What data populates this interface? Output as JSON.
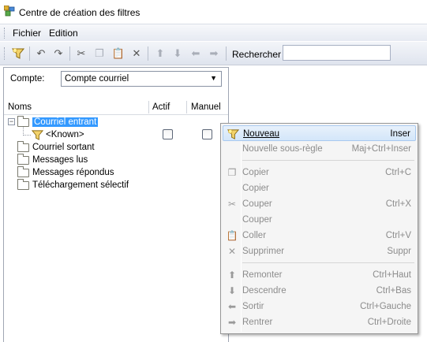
{
  "window": {
    "title": "Centre de création des filtres"
  },
  "menubar": {
    "file": "Fichier",
    "edit": "Edition"
  },
  "toolbar": {
    "search_label": "Rechercher",
    "search_value": ""
  },
  "account": {
    "label": "Compte:",
    "selected": "Compte courriel"
  },
  "columns": {
    "name": "Noms",
    "active": "Actif",
    "manual": "Manuel"
  },
  "tree": {
    "items": [
      {
        "label": "Courriel entrant"
      },
      {
        "label": "<Known>"
      },
      {
        "label": "Courriel sortant"
      },
      {
        "label": "Messages lus"
      },
      {
        "label": "Messages répondus"
      },
      {
        "label": "Téléchargement sélectif"
      }
    ]
  },
  "context_menu": {
    "items": [
      {
        "label": "Nouveau",
        "shortcut": "Inser"
      },
      {
        "label": "Nouvelle sous-règle",
        "shortcut": "Maj+Ctrl+Inser"
      },
      {
        "label": "Copier",
        "shortcut": "Ctrl+C"
      },
      {
        "label": "Copier",
        "shortcut": ""
      },
      {
        "label": "Couper",
        "shortcut": "Ctrl+X"
      },
      {
        "label": "Couper",
        "shortcut": ""
      },
      {
        "label": "Coller",
        "shortcut": "Ctrl+V"
      },
      {
        "label": "Supprimer",
        "shortcut": "Suppr"
      },
      {
        "label": "Remonter",
        "shortcut": "Ctrl+Haut"
      },
      {
        "label": "Descendre",
        "shortcut": "Ctrl+Bas"
      },
      {
        "label": "Sortir",
        "shortcut": "Ctrl+Gauche"
      },
      {
        "label": "Rentrer",
        "shortcut": "Ctrl+Droite"
      }
    ]
  },
  "icons": [
    "app-icon",
    "filter-icon",
    "undo-icon",
    "redo-icon",
    "cut-icon",
    "copy-icon",
    "paste-icon",
    "delete-icon",
    "up-icon",
    "down-icon",
    "left-icon",
    "right-icon",
    "folder-icon"
  ],
  "colors": {
    "selection": "#3399ff",
    "menu_bg": "#f5f5f5",
    "hover_border": "#a8c9ef"
  }
}
